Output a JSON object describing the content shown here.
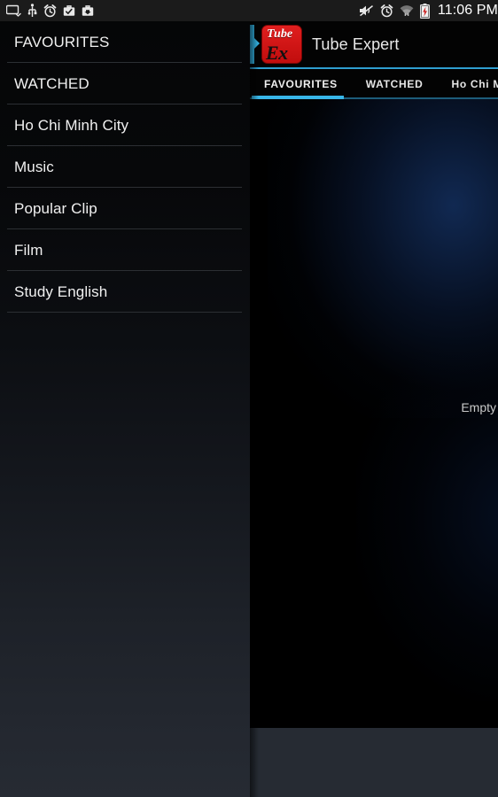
{
  "statusbar": {
    "time": "11:06 PM",
    "left_icons": [
      {
        "name": "screen-cast-icon",
        "glyph": "cast"
      },
      {
        "name": "usb-icon",
        "glyph": "usb"
      },
      {
        "name": "alarm-icon",
        "glyph": "alarm"
      },
      {
        "name": "app-install-icon",
        "glyph": "briefcase-check"
      },
      {
        "name": "app-download-icon",
        "glyph": "briefcase-arrow"
      }
    ],
    "right_icons": [
      {
        "name": "mute-icon",
        "glyph": "speaker-muted"
      },
      {
        "name": "alarm-set-icon",
        "glyph": "alarm"
      },
      {
        "name": "wifi-icon",
        "glyph": "wifi"
      },
      {
        "name": "battery-charging-icon",
        "glyph": "battery-charging"
      }
    ]
  },
  "sidebar": {
    "items": [
      {
        "label": "FAVOURITES"
      },
      {
        "label": "WATCHED"
      },
      {
        "label": "Ho Chi Minh City"
      },
      {
        "label": "Music"
      },
      {
        "label": "Popular Clip"
      },
      {
        "label": "Film"
      },
      {
        "label": "Study English"
      }
    ]
  },
  "header": {
    "app_title": "Tube Expert",
    "logo": {
      "top_text": "Tube",
      "bottom_text": "Ex",
      "background_color": "#d31414"
    },
    "drawer_handle_name": "drawer-handle",
    "accent_color": "#33b5e5"
  },
  "tabs": {
    "items": [
      {
        "label": "FAVOURITES",
        "active": true
      },
      {
        "label": "WATCHED",
        "active": false
      },
      {
        "label": "Ho Chi Minh City",
        "active": false
      }
    ],
    "active_index": 0,
    "indicator_color": "#38b6e8"
  },
  "content": {
    "empty_text": "Empty",
    "background_color": "#000000"
  },
  "colors": {
    "accent": "#33b5e5",
    "slate_background": "#262b33",
    "panel_background": "#000000",
    "logo_red": "#d31414"
  }
}
